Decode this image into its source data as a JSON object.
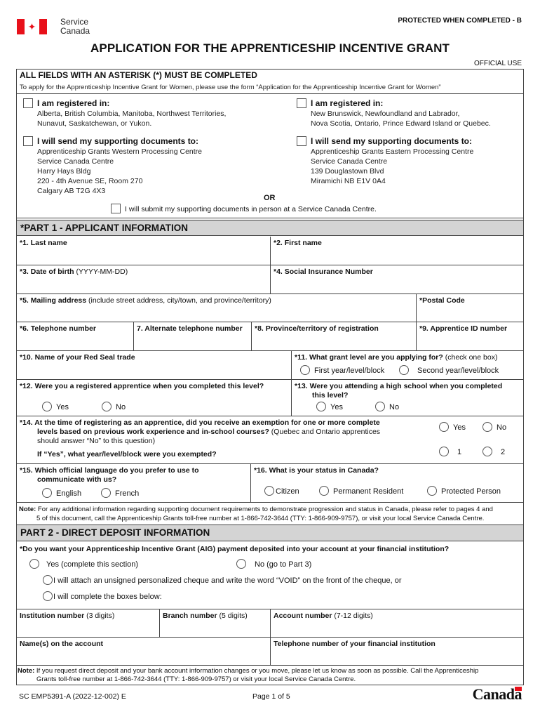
{
  "header": {
    "department_line1": "Service",
    "department_line2": "Canada",
    "classification": "PROTECTED WHEN COMPLETED - B",
    "title": "APPLICATION FOR THE APPRENTICESHIP INCENTIVE GRANT",
    "official_use": "OFFICIAL USE",
    "flag_icon": "canada-flag-icon"
  },
  "intro": {
    "required_notice": "ALL FIELDS WITH AN ASTERISK (*) MUST BE COMPLETED",
    "women_form_notice": "To apply for the Apprenticeship Incentive Grant for Women, please use the form “Application for the Apprenticeship Incentive Grant for Women”",
    "west": {
      "registered_label": "I am registered in:",
      "provinces_line1": "Alberta, British Columbia, Manitoba, Northwest Territories,",
      "provinces_line2": "Nunavut, Saskatchewan, or Yukon.",
      "send_label": "I will send my supporting documents to:",
      "address": [
        "Apprenticeship Grants Western Processing Centre",
        "Service Canada Centre",
        "Harry Hays Bldg",
        "220 - 4th Avenue SE, Room 270",
        "Calgary AB  T2G 4X3"
      ]
    },
    "east": {
      "registered_label": "I am registered in:",
      "provinces_line1": "New Brunswick, Newfoundland and Labrador,",
      "provinces_line2": "Nova Scotia, Ontario, Prince Edward Island or Quebec.",
      "send_label": "I will send my supporting documents to:",
      "address": [
        "Apprenticeship Grants Eastern Processing Centre",
        "Service Canada Centre",
        "139 Douglastown Blvd",
        "Miramichi NB  E1V 0A4"
      ]
    },
    "or_label": "OR",
    "in_person_label": "I will submit my supporting documents in person at a Service Canada Centre."
  },
  "part1": {
    "title": "*PART 1 - APPLICANT INFORMATION",
    "f1": "*1. Last name",
    "f2": "*2. First name",
    "f3_bold": "*3. Date of birth",
    "f3_hint": " (YYYY-MM-DD)",
    "f4": "*4. Social Insurance Number",
    "f5_bold": "*5. Mailing address",
    "f5_hint": " (include street address, city/town, and province/territory)",
    "postal": "*Postal Code",
    "f6": "*6. Telephone number",
    "f7": "7. Alternate telephone number",
    "f8": "*8. Province/territory of registration",
    "f9": "*9. Apprentice ID number",
    "f10": "*10. Name of your Red Seal trade",
    "f11_bold": "*11. What grant level are you applying for?",
    "f11_hint": " (check one box)",
    "f11_opt1": "First year/level/block",
    "f11_opt2": "Second year/level/block",
    "f12": "*12. Were you a registered apprentice when you completed this level?",
    "f12_yes": "Yes",
    "f12_no": "No",
    "f13_line1": "*13. Were you attending a high school when you completed",
    "f13_line2": "this level?",
    "f13_yes": "Yes",
    "f13_no": "No",
    "f14_line1": "*14. At the time of registering as an apprentice, did you receive an exemption for one or more complete",
    "f14_line2_bold": "levels based on previous work experience and in-school courses?",
    "f14_line2_hint": " (Quebec and Ontario apprentices",
    "f14_line3": "should answer “No” to this question)",
    "f14_yes": "Yes",
    "f14_no": "No",
    "f14_followup": "If “Yes”, what year/level/block were you exempted?",
    "f14_opt1": "1",
    "f14_opt2": "2",
    "f15_line1": "*15. Which official language do you prefer to use to",
    "f15_line2": "communicate with us?",
    "f15_english": "English",
    "f15_french": "French",
    "f16": "*16. What is your status in Canada?",
    "f16_citizen": "Citizen",
    "f16_pr": "Permanent Resident",
    "f16_protected": "Protected Person",
    "note_label": "Note:",
    "note_line1": " For any additional information regarding supporting document requirements to demonstrate progression and status in Canada, please refer to pages 4 and",
    "note_line2": "5 of this document, call the Apprenticeship Grants toll-free number at 1-866-742-3644 (TTY: 1-866-909-9757), or visit your local Service Canada Centre."
  },
  "part2": {
    "title": "PART 2 - DIRECT DEPOSIT INFORMATION",
    "question": "*Do you want your Apprenticeship Incentive Grant (AIG) payment deposited into your account at your financial institution?",
    "yes": "Yes (complete this section)",
    "no": "No (go to Part 3)",
    "cheque_option": "I will attach an unsigned personalized cheque and write the word “VOID” on the front of the cheque, or",
    "boxes_option": "I will complete the boxes below:",
    "institution_bold": "Institution number",
    "institution_hint": " (3 digits)",
    "branch_bold": "Branch number",
    "branch_hint": " (5 digits)",
    "account_bold": "Account number",
    "account_hint": " (7-12 digits)",
    "names": "Name(s) on the account",
    "fi_phone": "Telephone number of your financial institution",
    "note_label": "Note:",
    "note_line1": " If you request direct deposit and your bank account information changes or you move, please let us know as soon as possible. Call the Apprenticeship",
    "note_line2": "Grants toll-free number at 1-866-742-3644 (TTY: 1-866-909-9757) or visit your local Service Canada Centre."
  },
  "footer": {
    "form_code": "SC EMP5391-A (2022-12-002) E",
    "page": "Page 1 of 5",
    "wordmark": "Canada"
  }
}
